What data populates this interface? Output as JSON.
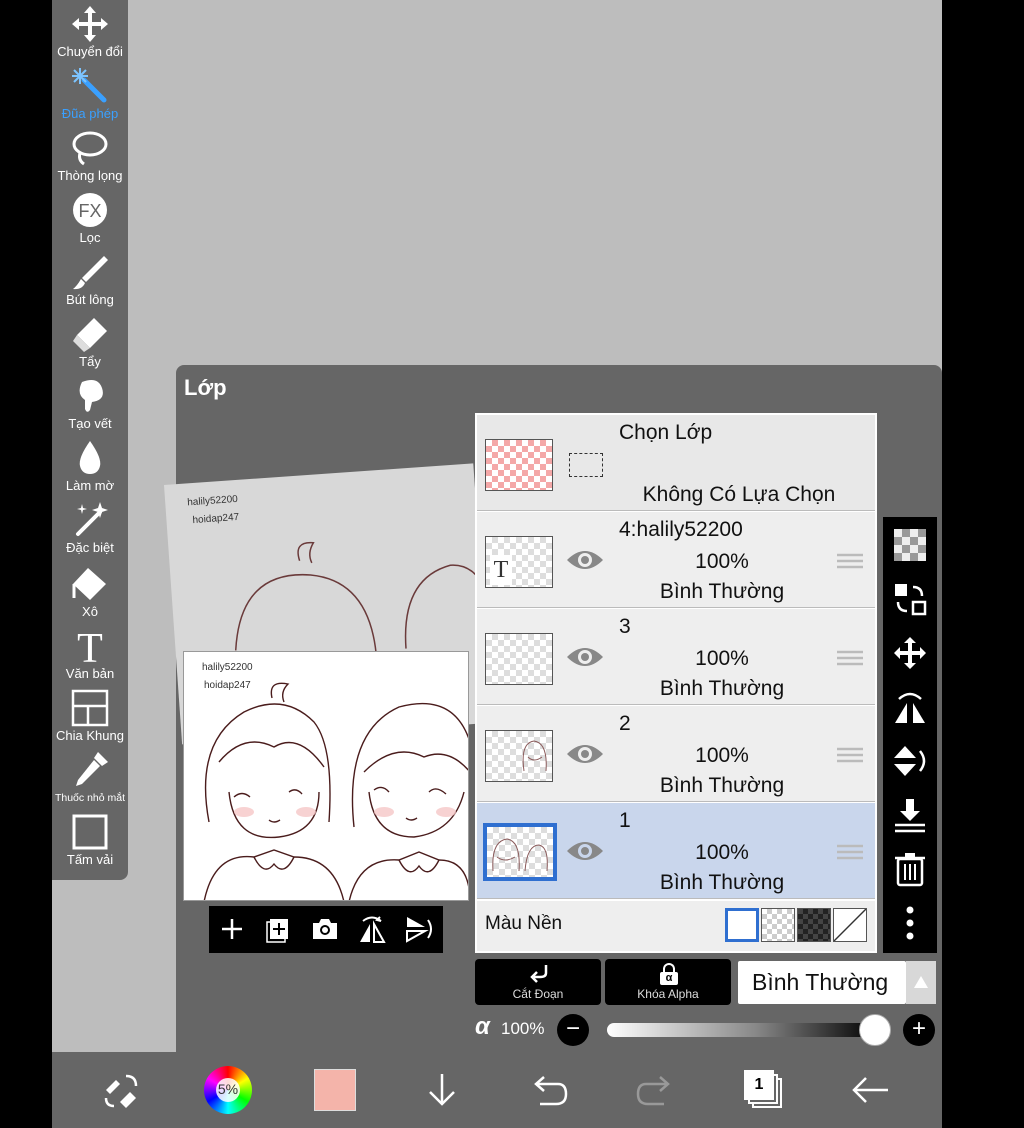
{
  "toolbar": {
    "items": [
      {
        "label": "Chuyển đổi",
        "icon": "move-arrows-icon"
      },
      {
        "label": "Đũa phép",
        "icon": "magic-wand-icon"
      },
      {
        "label": "Thòng lọng",
        "icon": "lasso-icon"
      },
      {
        "label": "Lọc",
        "icon": "fx-filter-icon"
      },
      {
        "label": "Bút lông",
        "icon": "brush-icon"
      },
      {
        "label": "Tẩy",
        "icon": "eraser-icon"
      },
      {
        "label": "Tạo vết",
        "icon": "smudge-icon"
      },
      {
        "label": "Làm mờ",
        "icon": "blur-drop-icon"
      },
      {
        "label": "Đặc biệt",
        "icon": "special-sparkle-icon"
      },
      {
        "label": "Xô",
        "icon": "bucket-icon"
      },
      {
        "label": "Văn bản",
        "icon": "text-icon"
      },
      {
        "label": "Chia Khung",
        "icon": "frame-divider-icon"
      },
      {
        "label": "Thuốc nhỏ mắt",
        "icon": "eyedropper-icon"
      },
      {
        "label": "Tấm vải",
        "icon": "canvas-icon"
      }
    ],
    "active_index": 1,
    "active_color": "#3aa0ff"
  },
  "layer_panel": {
    "title": "Lớp",
    "preview": {
      "watermark_1": "halily52200",
      "watermark_2": "hoidap247"
    },
    "selection_row": {
      "title": "Chọn Lớp",
      "status": "Không Có Lựa Chọn"
    },
    "layers": [
      {
        "name": "4:halily52200",
        "opacity": "100%",
        "mode": "Bình Thường",
        "thumb_letter": "T"
      },
      {
        "name": "3",
        "opacity": "100%",
        "mode": "Bình Thường"
      },
      {
        "name": "2",
        "opacity": "100%",
        "mode": "Bình Thường"
      },
      {
        "name": "1",
        "opacity": "100%",
        "mode": "Bình Thường",
        "active": true
      }
    ],
    "background": {
      "label": "Màu Nền"
    },
    "clip_button": "Cắt Đoạn",
    "alpha_lock_button": "Khóa Alpha",
    "alpha_lock_glyph": "α",
    "blend_mode": "Bình Thường",
    "opacity": {
      "symbol": "α",
      "value": "100%",
      "minus": "−",
      "plus": "+"
    }
  },
  "bottom_bar": {
    "color_wheel_value": "5%",
    "current_color": "#f4b4aa",
    "layer_count": "1"
  },
  "colors": {
    "panel": "#666666",
    "canvas": "#bdbdbd",
    "active_layer": "#c9d6ec",
    "selection_border": "#2f6fd0"
  }
}
